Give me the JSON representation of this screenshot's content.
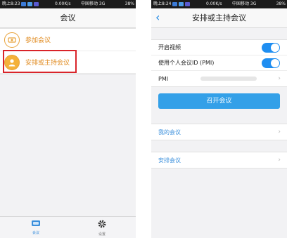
{
  "left": {
    "status": {
      "time": "晚上8:23",
      "speed": "0.00K/s",
      "carrier": "中国移动 3G",
      "battery": "38%"
    },
    "title": "会议",
    "items": [
      {
        "label": "参加会议",
        "icon": "join-meeting-icon"
      },
      {
        "label": "安排或主持会议",
        "icon": "host-person-icon"
      }
    ],
    "tabs": [
      {
        "label": "会议",
        "icon": "meeting-tab-icon"
      },
      {
        "label": "设置",
        "icon": "gear-icon"
      }
    ]
  },
  "right": {
    "status": {
      "time": "晚上8:24",
      "speed": "0.00K/s",
      "carrier": "中国移动 3G",
      "battery": "38%"
    },
    "title": "安排或主持会议",
    "settings": [
      {
        "label": "开启视频",
        "toggle": true
      },
      {
        "label": "使用个人会议ID (PMI)",
        "toggle": true
      },
      {
        "label": "PMI"
      }
    ],
    "start_button": "召开会议",
    "links": [
      {
        "label": "我的会议"
      },
      {
        "label": "安排会议"
      }
    ]
  },
  "colors": {
    "accent": "#1f8ef1",
    "highlight": "#d9242a",
    "orange": "#e08a1e"
  }
}
